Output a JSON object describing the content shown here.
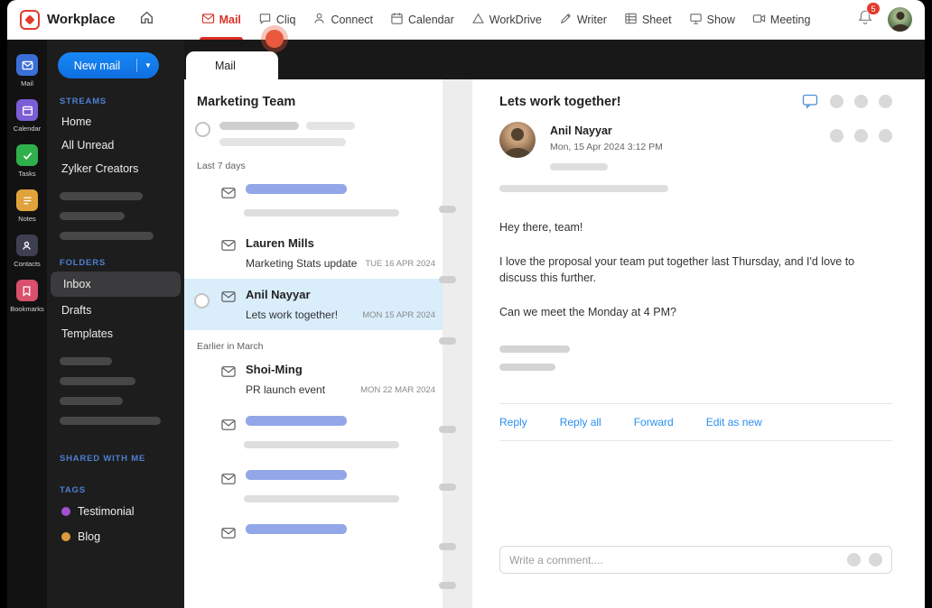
{
  "colors": {
    "accent_red": "#d93025",
    "accent_blue": "#0f74ee",
    "link_blue": "#2a8ff0",
    "selected_mail_bg": "#d9edfb",
    "skeleton_blue": "#93a7e8",
    "sidebar_label_blue": "#4e7fd2"
  },
  "topbar": {
    "brand": "Workplace",
    "nav_items": [
      {
        "label": "Mail",
        "icon": "mail-icon",
        "active": true
      },
      {
        "label": "Cliq",
        "icon": "chat-icon"
      },
      {
        "label": "Connect",
        "icon": "connect-icon"
      },
      {
        "label": "Calendar",
        "icon": "calendar-icon"
      },
      {
        "label": "WorkDrive",
        "icon": "drive-icon"
      },
      {
        "label": "Writer",
        "icon": "writer-icon"
      },
      {
        "label": "Sheet",
        "icon": "sheet-icon"
      },
      {
        "label": "Show",
        "icon": "show-icon"
      },
      {
        "label": "Meeting",
        "icon": "meeting-icon"
      }
    ],
    "notification_badge": "5"
  },
  "app_rail": {
    "items": [
      {
        "label": "Mail",
        "icon": "mail-icon",
        "color": "#3a6fd8"
      },
      {
        "label": "Calendar",
        "icon": "calendar-icon",
        "color": "#7b5dd6"
      },
      {
        "label": "Tasks",
        "icon": "tasks-icon",
        "color": "#2fb04b"
      },
      {
        "label": "Notes",
        "icon": "notes-icon",
        "color": "#e0a33c"
      },
      {
        "label": "Contacts",
        "icon": "contacts-icon",
        "color": "#3f3f52"
      },
      {
        "label": "Bookmarks",
        "icon": "bookmark-icon",
        "color": "#d8506b"
      }
    ]
  },
  "sidebar": {
    "new_mail_button": "New mail",
    "streams": {
      "label": "STREAMS",
      "items": [
        "Home",
        "All Unread",
        "Zylker Creators"
      ]
    },
    "folders": {
      "label": "FOLDERS",
      "items": [
        {
          "label": "Inbox",
          "selected": true
        },
        {
          "label": "Drafts"
        },
        {
          "label": "Templates"
        }
      ]
    },
    "shared_label": "SHARED WITH ME",
    "tags": {
      "label": "TAGS",
      "items": [
        {
          "label": "Testimonial",
          "color": "#a34fd0"
        },
        {
          "label": "Blog",
          "color": "#dd9b3e"
        }
      ]
    }
  },
  "tab": {
    "label": "Mail"
  },
  "mail_list": {
    "group_title": "Marketing Team",
    "section_last7": "Last 7 days",
    "section_march": "Earlier in March",
    "items": [
      {
        "sender": "Lauren Mills",
        "subject": "Marketing Stats update",
        "date": "TUE 16 APR 2024"
      },
      {
        "sender": "Anil Nayyar",
        "subject": "Lets work together!",
        "date": "MON 15 APR 2024",
        "selected": true
      },
      {
        "sender": "Shoi-Ming",
        "subject": "PR launch event",
        "date": "MON 22 MAR 2024"
      }
    ]
  },
  "reader": {
    "subject": "Lets work together!",
    "sender_name": "Anil Nayyar",
    "timestamp": "Mon,  15 Apr 2024  3:12 PM",
    "body": {
      "p1": "Hey there, team!",
      "p2": "I love the proposal your team put together last Thursday, and I'd love to discuss this further.",
      "p3": "Can we meet the Monday at 4 PM?"
    },
    "actions": [
      "Reply",
      "Reply all",
      "Forward",
      "Edit as new"
    ],
    "comment_placeholder": "Write a comment...."
  }
}
